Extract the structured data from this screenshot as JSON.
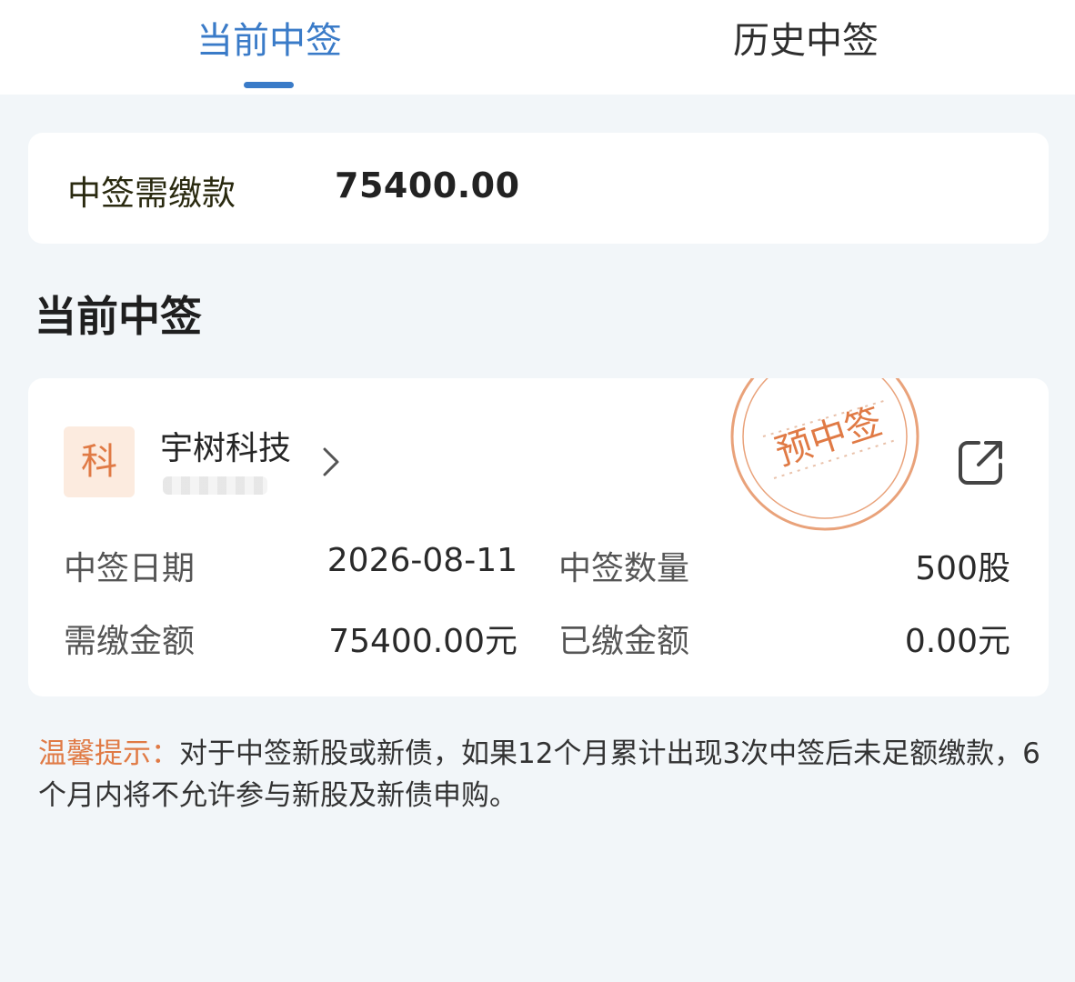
{
  "tabs": {
    "current": "当前中签",
    "history": "历史中签"
  },
  "summary": {
    "label": "中签需缴款",
    "value": "75400.00"
  },
  "section": {
    "title": "当前中签"
  },
  "stock": {
    "board": "科",
    "name": "宇树科技",
    "stamp_text": "预中签",
    "fields": {
      "date_label": "中签日期",
      "date_value": "2026-08-11",
      "qty_label": "中签数量",
      "qty_value": "500股",
      "due_label": "需缴金额",
      "due_value": "75400.00元",
      "paid_label": "已缴金额",
      "paid_value": "0.00元"
    }
  },
  "tip": {
    "label": "温馨提示：",
    "text": "对于中签新股或新债，如果12个月累计出现3次中签后未足额缴款，6个月内将不允许参与新股及新债申购。"
  },
  "colors": {
    "accent": "#3a7bc8",
    "stamp": "#e07a45",
    "background": "#f2f6f9"
  }
}
